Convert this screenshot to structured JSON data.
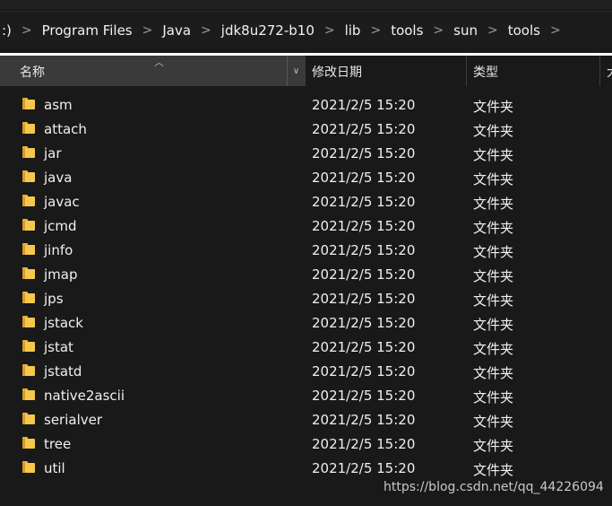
{
  "breadcrumb": {
    "items": [
      ":)",
      "Program Files",
      "Java",
      "jdk8u272-b10",
      "lib",
      "tools",
      "sun",
      "tools"
    ],
    "separator": ">"
  },
  "columns": {
    "name": "名称",
    "date_modified": "修改日期",
    "type": "类型",
    "size": "大"
  },
  "files": [
    {
      "name": "asm",
      "date": "2021/2/5 15:20",
      "type": "文件夹"
    },
    {
      "name": "attach",
      "date": "2021/2/5 15:20",
      "type": "文件夹"
    },
    {
      "name": "jar",
      "date": "2021/2/5 15:20",
      "type": "文件夹"
    },
    {
      "name": "java",
      "date": "2021/2/5 15:20",
      "type": "文件夹"
    },
    {
      "name": "javac",
      "date": "2021/2/5 15:20",
      "type": "文件夹"
    },
    {
      "name": "jcmd",
      "date": "2021/2/5 15:20",
      "type": "文件夹"
    },
    {
      "name": "jinfo",
      "date": "2021/2/5 15:20",
      "type": "文件夹"
    },
    {
      "name": "jmap",
      "date": "2021/2/5 15:20",
      "type": "文件夹"
    },
    {
      "name": "jps",
      "date": "2021/2/5 15:20",
      "type": "文件夹"
    },
    {
      "name": "jstack",
      "date": "2021/2/5 15:20",
      "type": "文件夹"
    },
    {
      "name": "jstat",
      "date": "2021/2/5 15:20",
      "type": "文件夹"
    },
    {
      "name": "jstatd",
      "date": "2021/2/5 15:20",
      "type": "文件夹"
    },
    {
      "name": "native2ascii",
      "date": "2021/2/5 15:20",
      "type": "文件夹"
    },
    {
      "name": "serialver",
      "date": "2021/2/5 15:20",
      "type": "文件夹"
    },
    {
      "name": "tree",
      "date": "2021/2/5 15:20",
      "type": "文件夹"
    },
    {
      "name": "util",
      "date": "2021/2/5 15:20",
      "type": "文件夹"
    }
  ],
  "watermark": "https://blog.csdn.net/qq_44226094",
  "colors": {
    "background": "#191919",
    "header_selected": "#3a3a3a",
    "folder": "#f5c84d"
  },
  "icons": {
    "folder": "folder-icon",
    "separator": "chevron-right-icon",
    "sort": "sort-ascending-icon",
    "dropdown": "chevron-down-icon"
  }
}
